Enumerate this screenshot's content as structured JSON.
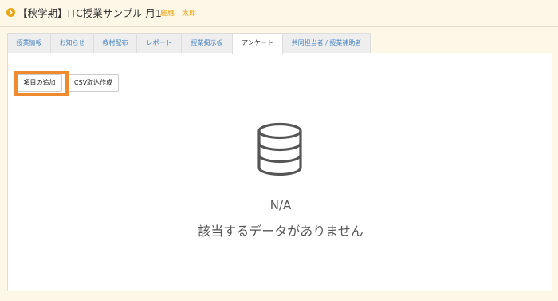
{
  "header": {
    "course_title": "【秋学期】ITC授業サンプル 月1",
    "teacher": "慶應　太郎",
    "accent_color": "#e8a617"
  },
  "tabs": [
    {
      "label": "授業情報",
      "active": false
    },
    {
      "label": "お知らせ",
      "active": false
    },
    {
      "label": "教材配布",
      "active": false
    },
    {
      "label": "レポート",
      "active": false
    },
    {
      "label": "授業掲示板",
      "active": false
    },
    {
      "label": "アンケート",
      "active": true
    },
    {
      "label": "共同担当者 / 授業補助者",
      "active": false
    }
  ],
  "toolbar": {
    "add_item_label": "項目の追加",
    "csv_label": "CSV取込作成",
    "highlight_color": "#f08a2e"
  },
  "empty_state": {
    "icon": "database-icon",
    "na_label": "N/A",
    "message": "該当するデータがありません"
  }
}
